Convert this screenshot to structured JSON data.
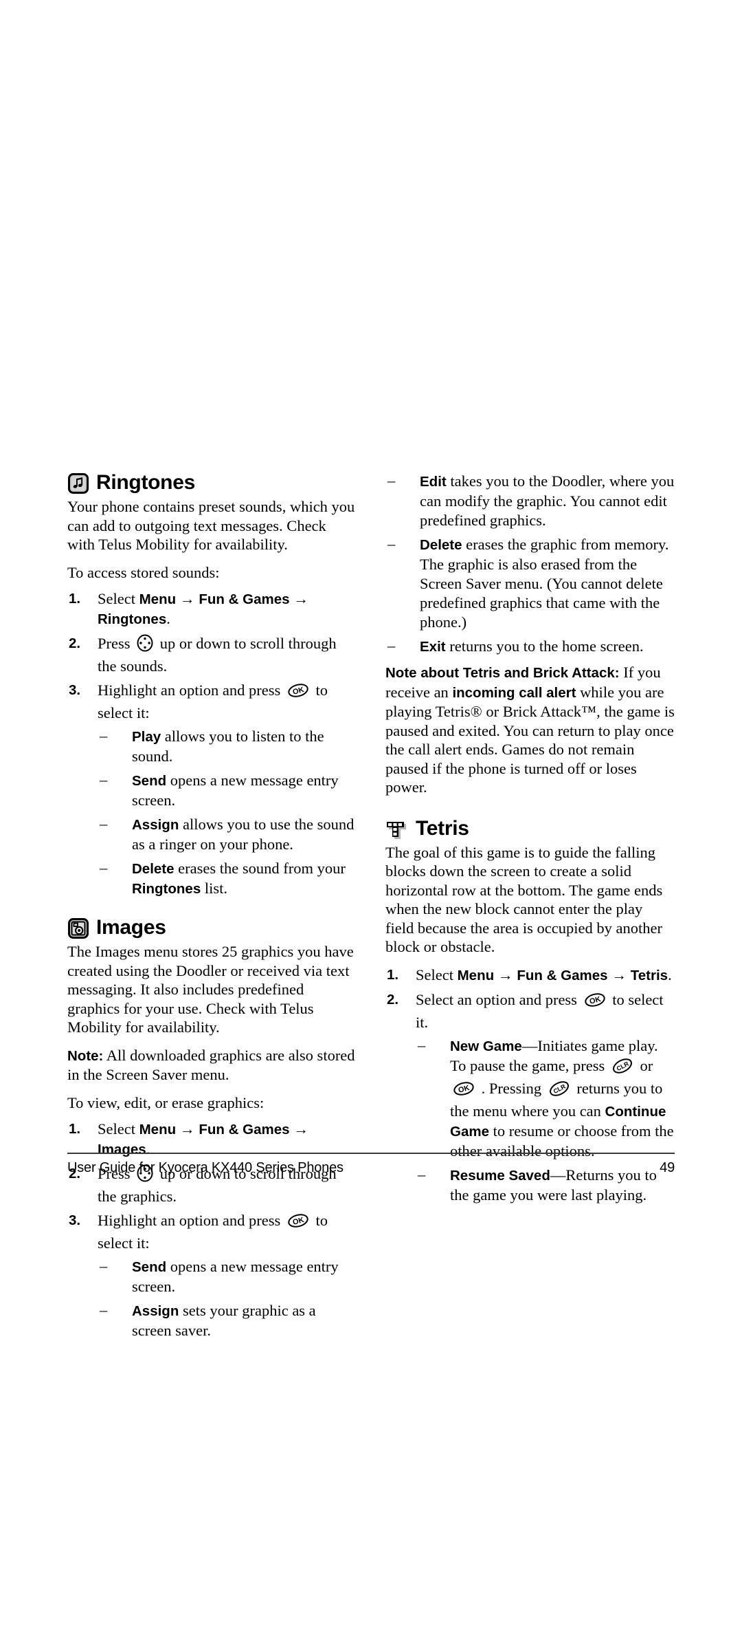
{
  "document": {
    "footer_title": "User Guide for Kyocera KX440 Series Phones",
    "page_number": "49"
  },
  "left_column": {
    "ringtones": {
      "icon": "music-note-icon",
      "heading": "Ringtones",
      "intro": "Your phone contains preset sounds, which you can add to outgoing text messages. Check with Telus Mobility for availability.",
      "lead_in": "To access stored sounds:",
      "steps": [
        {
          "num": "1.",
          "pre": "Select ",
          "bold1": "Menu",
          "arrow1": "→",
          "bold2": "Fun & Games",
          "arrow2": "→",
          "bold3": "Ringtones",
          "post": "."
        },
        {
          "num": "2.",
          "pre": "Press ",
          "key": "navigation-key-icon",
          "post": " up or down to scroll through the sounds."
        },
        {
          "num": "3.",
          "pre": "Highlight an option and press ",
          "key": "ok-key-icon",
          "post": " to select it:"
        }
      ],
      "options": [
        {
          "term": "Play",
          "desc": " allows you to listen to the sound."
        },
        {
          "term": "Send",
          "desc": " opens a new message entry screen."
        },
        {
          "term": "Assign",
          "desc": " allows you to use the sound as a ringer on your phone."
        },
        {
          "term": "Delete",
          "desc": " erases the sound from your ",
          "term2": "Ringtones",
          "desc2": " list."
        }
      ]
    },
    "images": {
      "icon": "picture-camera-icon",
      "heading": "Images",
      "intro": "The Images menu stores 25 graphics you have created using the Doodler or received via text messaging. It also includes predefined graphics for your use. Check with Telus Mobility for availability.",
      "note_label": "Note:",
      "note_body": " All downloaded graphics are also stored in the Screen Saver menu.",
      "lead_in": "To view, edit, or erase graphics:",
      "steps": [
        {
          "num": "1.",
          "pre": "Select ",
          "bold1": "Menu",
          "arrow1": "→",
          "bold2": "Fun & Games",
          "arrow2": "→",
          "bold3": "Images",
          "post": "."
        },
        {
          "num": "2.",
          "pre": "Press ",
          "key": "navigation-key-icon",
          "post": " up or down to scroll through the graphics."
        },
        {
          "num": "3.",
          "pre": "Highlight an option and press ",
          "key": "ok-key-icon",
          "post": " to select it:"
        }
      ],
      "options": [
        {
          "term": "Send",
          "desc": " opens a new message entry screen."
        },
        {
          "term": "Assign",
          "desc": " sets your graphic as a screen saver."
        }
      ]
    }
  },
  "right_column": {
    "images_options_continued": [
      {
        "term": "Edit",
        "desc": " takes you to the Doodler, where you can modify the graphic. You cannot edit predefined graphics."
      },
      {
        "term": "Delete",
        "desc": " erases the graphic from memory. The graphic is also erased from the Screen Saver menu. (You cannot delete predefined graphics that came with the phone.)"
      },
      {
        "term": "Exit",
        "desc": " returns you to the home screen."
      }
    ],
    "game_note": {
      "label": "Note about Tetris and Brick Attack:",
      "part1": " If you receive an ",
      "bold_inline": "incoming call alert",
      "part2": " while you are playing Tetris® or Brick Attack™, the game is paused and exited. You can return to play once the call alert ends. Games do not remain paused if the phone is turned off or loses power."
    },
    "tetris": {
      "icon": "tetris-block-icon",
      "heading": "Tetris",
      "intro": "The goal of this game is to guide the falling blocks down the screen to create a solid horizontal row at the bottom. The game ends when the new block cannot enter the play field because the area is occupied by another block or obstacle.",
      "steps": [
        {
          "num": "1.",
          "pre": "Select ",
          "bold1": "Menu",
          "arrow1": "→",
          "bold2": "Fun & Games",
          "arrow2": "→",
          "bold3": "Tetris",
          "post": "."
        },
        {
          "num": "2.",
          "pre": "Select an option and press ",
          "key": "ok-key-icon",
          "post": " to select it."
        }
      ],
      "options": [
        {
          "term": "New Game",
          "desc_a": "—Initiates game play. To pause the game, press ",
          "key_a": "clr-key-icon",
          "desc_b": " or ",
          "key_b": "ok-key-icon",
          "desc_c": " . Pressing ",
          "key_c": "clr-key-icon",
          "desc_d": " returns you to the menu where you can ",
          "term_b": "Continue Game",
          "desc_e": " to resume or choose from the other available options."
        },
        {
          "term": "Resume Saved",
          "desc_a": "—Returns you to the game you were last playing."
        }
      ]
    }
  }
}
